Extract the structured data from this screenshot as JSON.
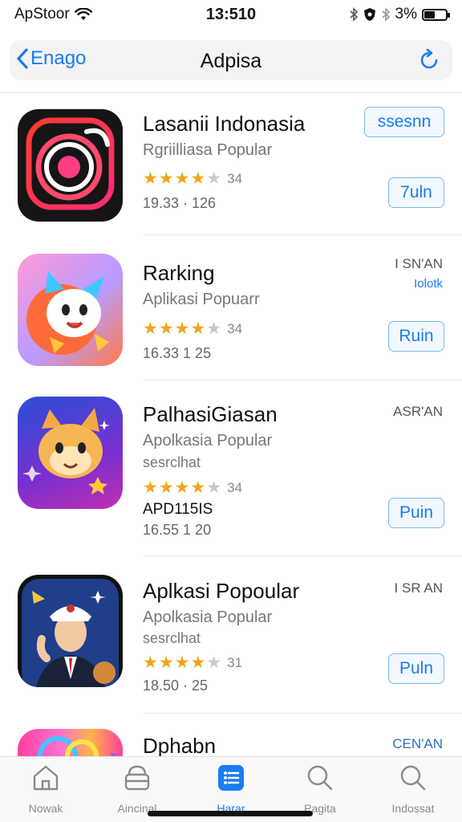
{
  "status_bar": {
    "carrier": "ApStoor",
    "time": "13:510",
    "battery": "3%"
  },
  "nav": {
    "back_label": "Enago",
    "title": "Adpisa"
  },
  "apps": [
    {
      "name": "Lasanii Indonasia",
      "subtitle": "Rgriilliasa Popular",
      "rating": 4.5,
      "rating_count": "34",
      "meta": "19.33 · 126",
      "button_top": "ssesnn",
      "button": "7uln"
    },
    {
      "name": "Rarking",
      "subtitle": "Aplikasi Popuarr",
      "rating": 4.5,
      "rating_count": "34",
      "meta": "16.33 1 25",
      "side_top": "I SN'AN",
      "side_bottom": "Iolotk",
      "button": "Ruin"
    },
    {
      "name": "PalhasiGiasan",
      "subtitle": "Apolkasia Popular",
      "extra": "sesrclhat",
      "rating": 4.5,
      "rating_count": "34",
      "code": "APD115IS",
      "meta": "16.55 1 20",
      "side_top": "ASR'AN",
      "button": "Puin"
    },
    {
      "name": "Aplkasi Popoular",
      "subtitle": "Apolkasia Popular",
      "extra": "sesrclhat",
      "rating": 4.5,
      "rating_count": "31",
      "meta": "18.50 · 25",
      "side_top": "I SR AN",
      "button": "Puln"
    },
    {
      "name": "Dphabn",
      "side_top": "CEN'AN"
    }
  ],
  "tabs": [
    {
      "label": "Nowak",
      "icon": "home-icon"
    },
    {
      "label": "Aincinal",
      "icon": "archive-icon"
    },
    {
      "label": "Harar",
      "icon": "list-icon",
      "active": true
    },
    {
      "label": "Pagita",
      "icon": "search-icon"
    },
    {
      "label": "Indossat",
      "icon": "search-icon"
    }
  ],
  "colors": {
    "accent": "#1a7cf0",
    "star": "#f1a41a"
  }
}
